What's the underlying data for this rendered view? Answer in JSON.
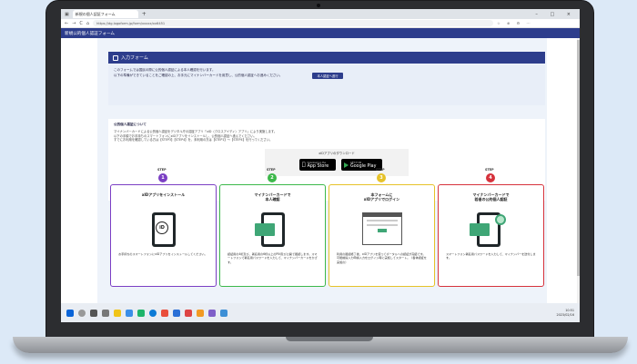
{
  "browser": {
    "tab_title": "新規の個人認証フォーム",
    "new_tab": "+",
    "window_controls": "–  □  ×",
    "url": "https://dg.logoform.jp/form/xxxxx/xx6451",
    "nav_back": "←",
    "nav_forward": "→",
    "nav_reload": "C",
    "nav_home": "⌂"
  },
  "site": {
    "title": "新規公的個人認証フォーム"
  },
  "form": {
    "header": "入力フォーム",
    "intro_line1": "このフォームでは国民の際に公的個人認証による本人確認を行います。",
    "intro_line2": "以下の準備ができていることをご確認の上、お手元にマイナンバーカードを用意し、公的個人認証へお進みください。",
    "button": "本人認証へ進行"
  },
  "about": {
    "heading": "公的個人認証について",
    "line1": "マイナンバーカードによる公的個人認証をデジタル庁の認証アプリ「xID（クロスアイディ）アプリ」により実施します。",
    "line2": "以下の手順でお手持ちのスマートフォンにxIDアプリをインストールし、公的個人認証へ進んでください。",
    "line3": "すでにお利用を確認している方は【STEP3】【STEP4】を、未利用の方は【STEP1】～【STEP4】を行ってください。",
    "download_title": "xIDアプリのダウンロード",
    "appstore_small": "Download on the",
    "appstore_big": "App Store",
    "google_small": "GET IT ON",
    "google_big": "Google Play"
  },
  "steps": [
    {
      "label": "STEP",
      "num": "1",
      "title": "xIDアプリをインストール",
      "desc": "お手持ちのスマートフォンにxIDアプリをインストールしてください。"
    },
    {
      "label": "STEP",
      "num": "2",
      "title": "マイナンバーカードで\n本人確認",
      "desc": "認証用の4桁及び、署名用の6桁以上のPIN及び公開で確認します。スマートフォンで署名用パスワードを入力して、マイナンバーカードをかざす。"
    },
    {
      "label": "STEP",
      "num": "3",
      "title": "本フォームに\nxIDアプリでログイン",
      "desc": "利用の確認終了後、xIDアプリを使ってポータルへの認証が完結です。可能前提入力申請入力をログイン時に実施してスタート。（各体認証を実施の）"
    },
    {
      "label": "STEP",
      "num": "4",
      "title": "マイナンバーカードで\n若者の公的個人認証",
      "desc": "スマートフォン署名用パスワードを入力して、マイナンバーを送付します。"
    }
  ],
  "taskbar": {
    "time": "10:51",
    "date": "2023/02/16"
  },
  "colors": {
    "header": "#2d3d8c",
    "step1": "#7b3fc4",
    "step2": "#3cb84a",
    "step3": "#e6c229",
    "step4": "#d6323c",
    "background": "#dce9f7"
  }
}
